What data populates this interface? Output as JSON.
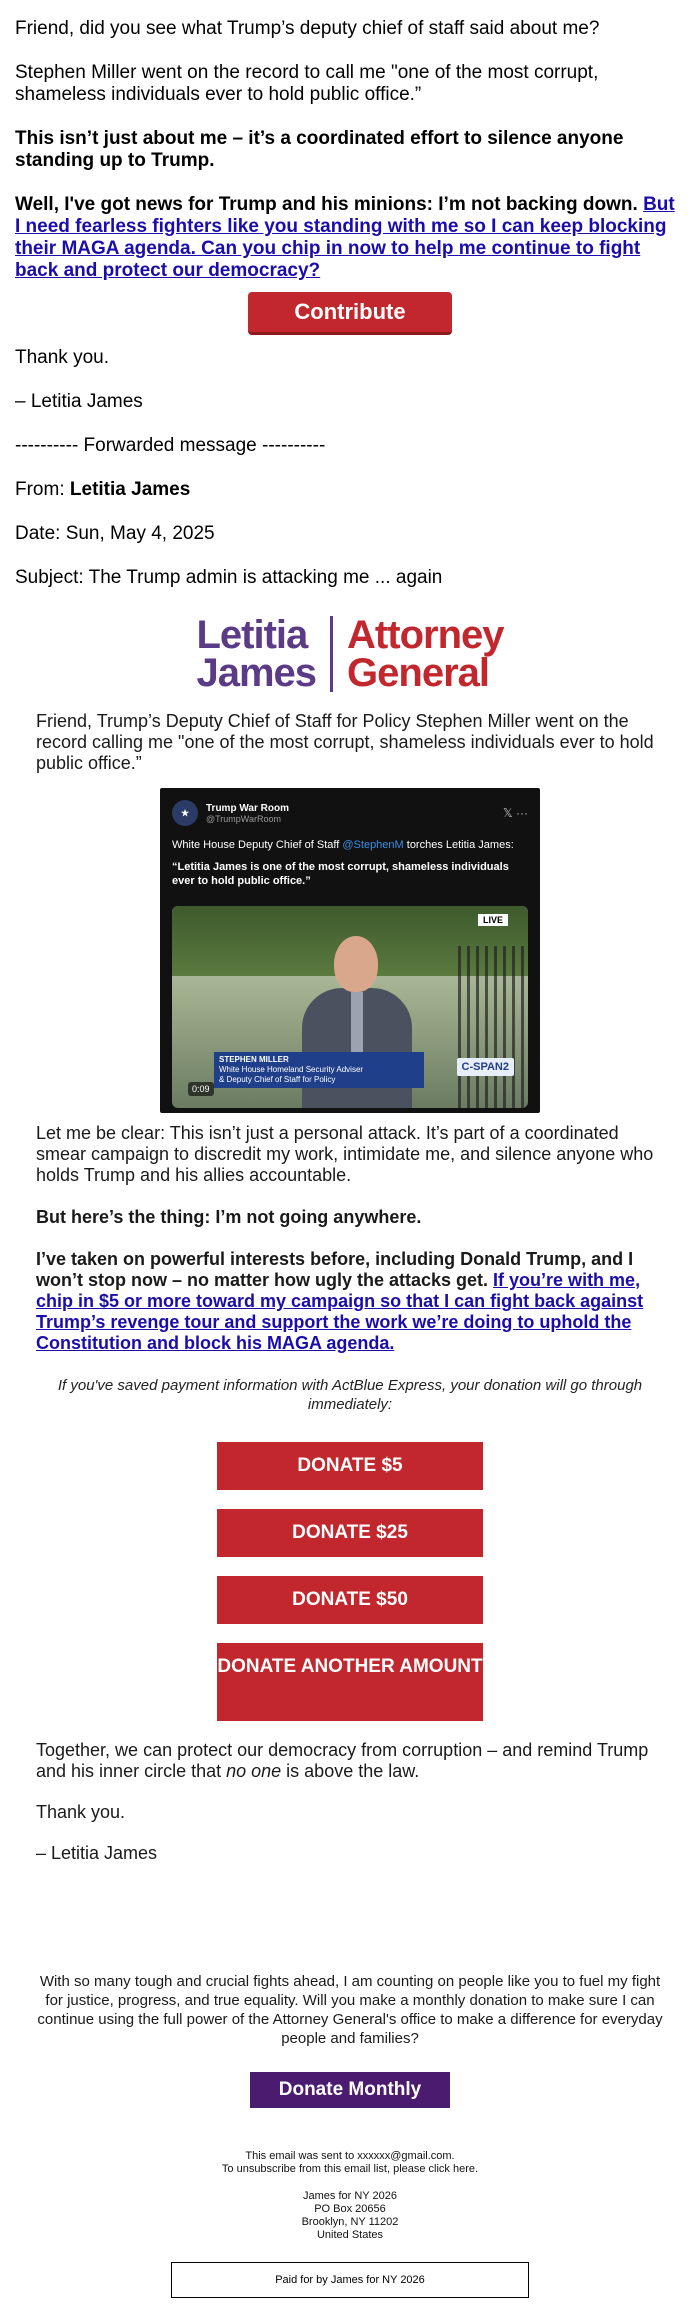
{
  "intro": {
    "line1": "Friend, did you see what Trump’s deputy chief of staff said about me?",
    "line2": "Stephen Miller went on the record to call me \"one of the most corrupt, shameless individuals ever to hold public office.”",
    "line3": "This isn’t just about me – it’s a coordinated effort to silence anyone standing up to Trump.",
    "line4_bold": "Well, I've got news for Trump and his minions: I’m not backing down. ",
    "line4_link": "But I need fearless fighters like you standing with me so I can keep blocking their MAGA agenda. Can you chip in now to help me continue to fight back and protect our democracy?",
    "contribute_label": "Contribute",
    "thanks": "Thank you.",
    "sign": "– Letitia James"
  },
  "forward": {
    "divider": "---------- Forwarded message ----------",
    "from_label": "From: ",
    "from_name": "Letitia James",
    "date": "Date: Sun, May 4, 2025",
    "subject": "Subject: The Trump admin is attacking me ... again"
  },
  "logo": {
    "line1a": "Letitia",
    "line1b": "James",
    "line2a": "Attorney",
    "line2b": "General",
    "colors": {
      "purple": "#5b3a86",
      "red": "#c1272d"
    }
  },
  "body": {
    "p1": "Friend, Trump’s Deputy Chief of Staff for Policy Stephen Miller went on the record calling me \"one of the most corrupt, shameless individuals ever to hold public office.”",
    "video": {
      "account_name": "Trump War Room",
      "account_handle": "@TrumpWarRoom",
      "text_a": "White House Deputy Chief of Staff ",
      "mention": "@StephenM",
      "text_b": " torches Letitia James:",
      "quote": "“Letitia James is one of the most corrupt, shameless individuals ever to hold public office.”",
      "live": "LIVE",
      "lower_name": "STEPHEN MILLER",
      "lower_title1": "White House Homeland Security Adviser",
      "lower_title2": "& Deputy Chief of Staff for Policy",
      "network": "C-SPAN2",
      "duration": "0:09"
    },
    "p2": "Let me be clear: This isn’t just a personal attack. It’s part of a coordinated smear campaign to discredit my work, intimidate me, and silence anyone who holds Trump and his allies accountable.",
    "p3": "But here’s the thing: I’m not going anywhere.",
    "p4_bold": "I’ve taken on powerful interests before, including Donald Trump, and I won’t stop now – no matter how ugly the attacks get. ",
    "p4_link": "If you’re with me, chip in $5 or more toward my campaign so that I can fight back against Trump’s revenge tour and support the work we’re doing to uphold the Constitution and block his MAGA agenda.",
    "express_note": "If you've saved payment information with ActBlue Express, your donation will go through immediately:",
    "donate_5": "DONATE $5",
    "donate_25": "DONATE $25",
    "donate_50": "DONATE $50",
    "donate_other": "DONATE ANOTHER AMOUNT",
    "p5a": "Together, we can protect our democracy from corruption – and remind Trump and his inner circle that ",
    "p5_em": "no one",
    "p5b": " is above the law.",
    "thanks": "Thank you.",
    "sign": "– Letitia James"
  },
  "footer": {
    "ask": "With so many tough and crucial fights ahead, I am counting on people like you to fuel my fight for justice, progress, and true equality. Will you make a monthly donation to make sure I can continue using the full power of the Attorney General's office to make a difference for everyday people and families?",
    "monthly_label": "Donate Monthly",
    "sent_to": "This email was sent to xxxxxx@gmail.com.",
    "unsubscribe": "To unsubscribe from this email list, please click here.",
    "addr1": "James for NY 2026",
    "addr2": "PO Box 20656",
    "addr3": "Brooklyn, NY 11202",
    "addr4": "United States",
    "paid_for": "Paid for by James for NY 2026"
  }
}
